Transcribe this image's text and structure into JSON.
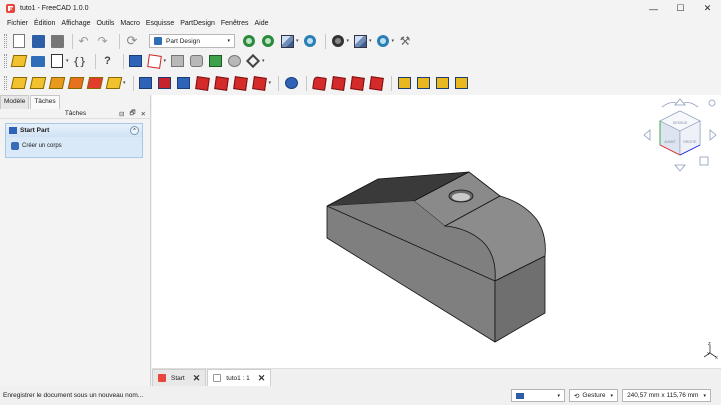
{
  "window": {
    "title": "tuto1 - FreeCAD 1.0.0",
    "minimize_glyph": "—",
    "maximize_glyph": "☐",
    "close_glyph": "✕"
  },
  "menubar": {
    "items": [
      "Fichier",
      "Édition",
      "Affichage",
      "Outils",
      "Macro",
      "Esquisse",
      "PartDesign",
      "Fenêtres",
      "Aide"
    ]
  },
  "toolbar": {
    "workbench_label": "Part Design",
    "dropdown_glyph": "▾"
  },
  "panel": {
    "tabs": [
      "Modèle",
      "Tâches"
    ],
    "active_tab": "Tâches",
    "header": "Tâches",
    "header_buttons": [
      "⊟",
      "🗗",
      "✕"
    ],
    "taskbox_title": "Start Part",
    "taskbox_collapse_glyph": "⌃",
    "taskbox_action": "Créer un corps"
  },
  "viewport": {
    "navcube_faces": [
      "DESSUS",
      "AVANT",
      "DROITE"
    ],
    "axis_labels": [
      "Z",
      "Y",
      "X"
    ]
  },
  "doc_tabs": [
    {
      "label": "Start",
      "close": "✕",
      "active": false
    },
    {
      "label": "tuto1 : 1",
      "close": "✕",
      "active": true
    }
  ],
  "statusbar": {
    "message": "Enregistrer le document sous un nouveau nom...",
    "navigation_style": "Gesture",
    "dimensions": "240,57 mm x 115,76 mm",
    "dropdown_glyph": "▾"
  },
  "colors": {
    "model_face": "#7f7f7f",
    "model_top": "#3a3a3a",
    "accent_blue": "#2f63b8",
    "taskbox_bg": "#d9e9f7"
  }
}
